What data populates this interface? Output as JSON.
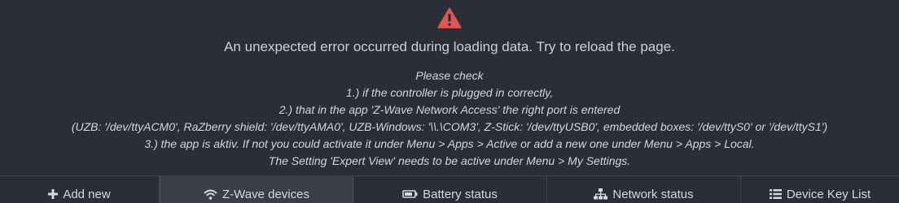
{
  "error": {
    "icon": "warning-triangle-icon",
    "icon_color": "#e05555",
    "title": "An unexpected error occurred during loading data. Try to reload the page.",
    "hint_lines": [
      "Please check",
      "1.) if the controller is plugged in correctly,",
      "2.) that in the app 'Z-Wave Network Access' the right port is entered",
      "(UZB: '/dev/ttyACM0', RaZberry shield: '/dev/ttyAMA0', UZB-Windows: '\\\\.\\COM3', Z-Stick: '/dev/ttyUSB0', embedded boxes: '/dev/ttyS0' or '/dev/ttyS1')",
      "3.) the app is aktiv. If not you could activate it under Menu > Apps > Active or add a new one under Menu > Apps > Local.",
      "The Setting 'Expert View' needs to be active under Menu > My Settings."
    ]
  },
  "tabs": [
    {
      "label": "Add new",
      "icon": "plus-icon",
      "active": false
    },
    {
      "label": "Z-Wave devices",
      "icon": "wifi-icon",
      "active": true
    },
    {
      "label": "Battery status",
      "icon": "battery-icon",
      "active": false
    },
    {
      "label": "Network status",
      "icon": "sitemap-icon",
      "active": false
    },
    {
      "label": "Device Key List",
      "icon": "list-icon",
      "active": false
    }
  ]
}
